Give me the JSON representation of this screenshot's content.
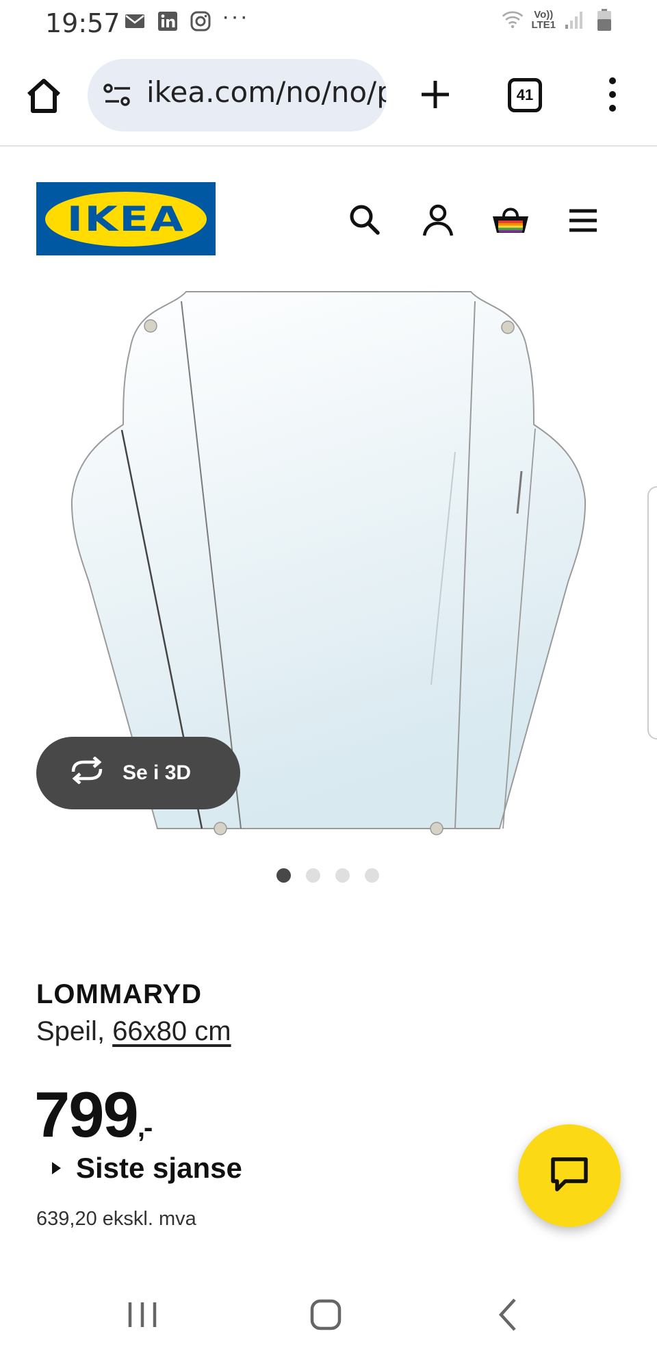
{
  "status_bar": {
    "time": "19:57",
    "notification_icons": [
      "mail-icon",
      "linkedin-icon",
      "instagram-icon"
    ],
    "overflow": "···",
    "network_label_top": "Vo))",
    "network_label_bottom": "LTE1"
  },
  "browser": {
    "url": "ikea.com/no/no/p",
    "tab_count": "41"
  },
  "header": {
    "logo_text": "IKEA",
    "icons": [
      "search-icon",
      "account-icon",
      "basket-icon",
      "hamburger-menu-icon"
    ]
  },
  "gallery": {
    "view_3d_label": "Se i 3D",
    "image_count": 4,
    "active_index": 0
  },
  "product": {
    "name": "LOMMARYD",
    "type": "Speil,",
    "size": "66x80 cm",
    "price": "799",
    "price_suffix": ",-",
    "badge": "Siste sjanse",
    "price_ex_vat": "639,20 ekskl. mva"
  },
  "colors": {
    "ikea_blue": "#0058a3",
    "ikea_yellow": "#ffdb00",
    "chat_yellow": "#fbd914",
    "dark_button": "#484848",
    "url_bar_bg": "#e8ecf5"
  }
}
